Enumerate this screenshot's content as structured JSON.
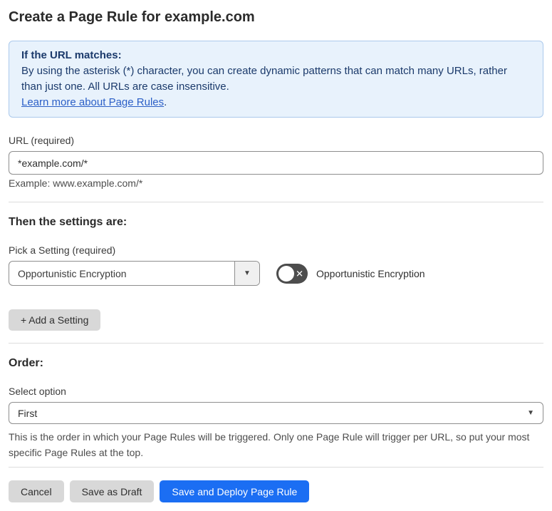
{
  "page": {
    "title": "Create a Page Rule for example.com"
  },
  "info_box": {
    "heading": "If the URL matches:",
    "body": "By using the asterisk (*) character, you can create dynamic patterns that can match many URLs, rather than just one. All URLs are case insensitive.",
    "link_label": "Learn more about Page Rules",
    "link_suffix": "."
  },
  "url_section": {
    "label": "URL (required)",
    "input_value": "*example.com/*",
    "helper": "Example: www.example.com/*"
  },
  "settings_section": {
    "heading": "Then the settings are:",
    "picker_label": "Pick a Setting (required)",
    "picker_value": "Opportunistic Encryption",
    "toggle_state": "off",
    "toggle_label": "Opportunistic Encryption",
    "add_button_label": "+ Add a Setting"
  },
  "order_section": {
    "heading": "Order:",
    "select_label": "Select option",
    "select_value": "First",
    "helper": "This is the order in which your Page Rules will be triggered. Only one Page Rule will trigger per URL, so put your most specific Page Rules at the top."
  },
  "footer": {
    "cancel_label": "Cancel",
    "save_draft_label": "Save as Draft",
    "save_deploy_label": "Save and Deploy Page Rule"
  },
  "icons": {
    "picker_arrow": "▼",
    "order_arrow": "▼",
    "toggle_x": "✕"
  },
  "colors": {
    "accent_blue": "#1b6ef3",
    "info_background": "#e8f2fc",
    "info_border": "#abc9ec",
    "info_text": "#1b3a6b",
    "link_blue": "#2b5fc7",
    "toggle_off_background": "#4d4d4d",
    "gray_button_background": "#d8d8d8"
  }
}
